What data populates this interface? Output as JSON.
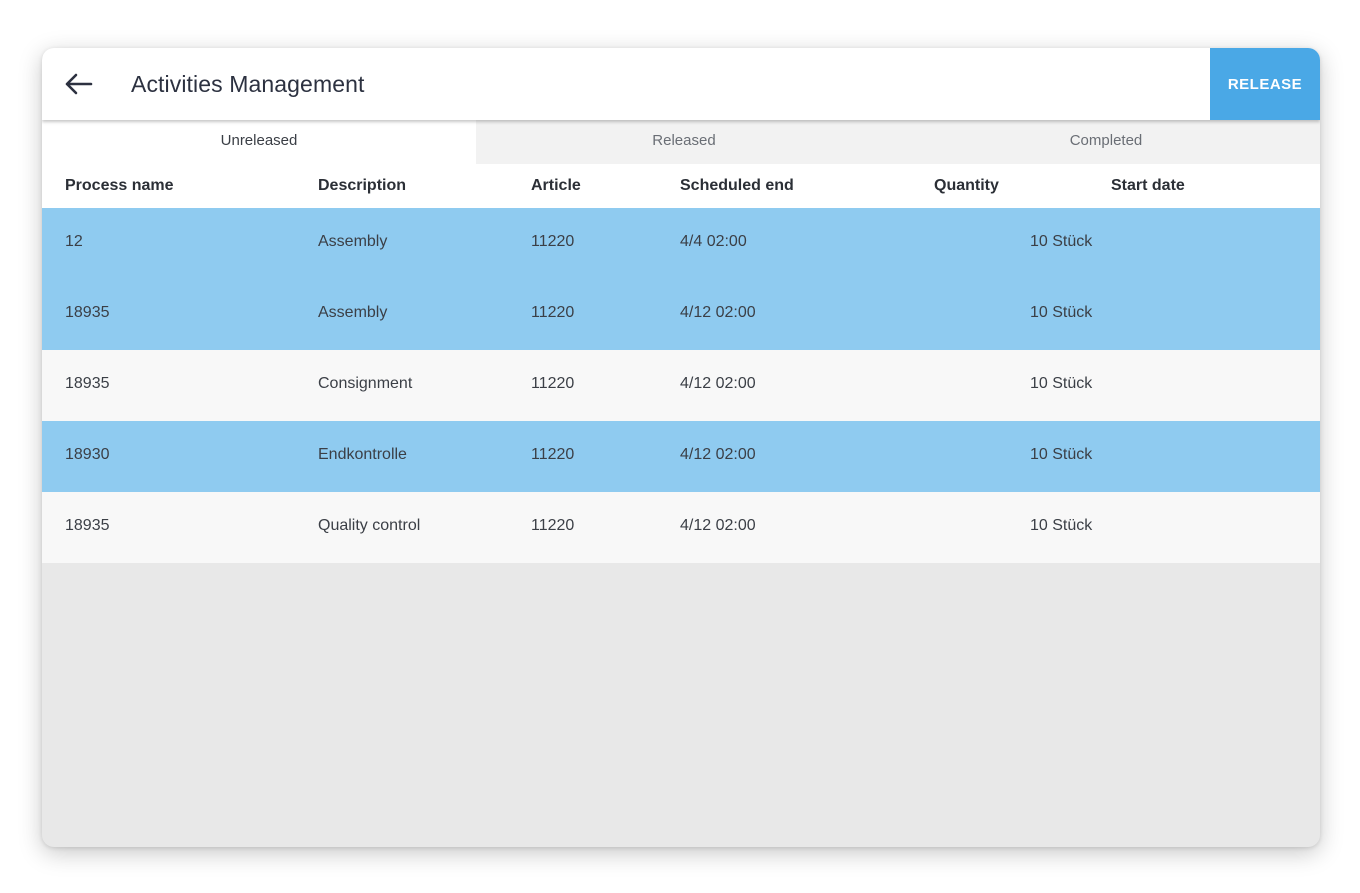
{
  "header": {
    "title": "Activities Management",
    "release_label": "RELEASE"
  },
  "tabs": [
    {
      "label": "Unreleased",
      "active": true
    },
    {
      "label": "Released",
      "active": false
    },
    {
      "label": "Completed",
      "active": false
    }
  ],
  "columns": {
    "process_name": "Process name",
    "description": "Description",
    "article": "Article",
    "scheduled_end": "Scheduled end",
    "quantity": "Quantity",
    "start_date": "Start date"
  },
  "rows": [
    {
      "process_name": "12",
      "description": "Assembly",
      "article": "11220",
      "scheduled_end": "4/4  02:00",
      "quantity": "10 Stück",
      "start_date": "",
      "selected": true
    },
    {
      "process_name": "18935",
      "description": "Assembly",
      "article": "11220",
      "scheduled_end": "4/12  02:00",
      "quantity": "10 Stück",
      "start_date": "",
      "selected": true
    },
    {
      "process_name": "18935",
      "description": "Consignment",
      "article": "11220",
      "scheduled_end": "4/12  02:00",
      "quantity": "10 Stück",
      "start_date": "",
      "selected": false
    },
    {
      "process_name": "18930",
      "description": "Endkontrolle",
      "article": "11220",
      "scheduled_end": "4/12  02:00",
      "quantity": "10 Stück",
      "start_date": "",
      "selected": true
    },
    {
      "process_name": "18935",
      "description": "Quality control",
      "article": "11220",
      "scheduled_end": "4/12  02:00",
      "quantity": "10 Stück",
      "start_date": "",
      "selected": false
    }
  ],
  "colors": {
    "accent": "#4aa8e6",
    "selected_row": "#8fcbf0",
    "row": "#f8f8f8",
    "empty_area": "#e8e8e8"
  },
  "icons": {
    "back": "arrow-left-icon"
  }
}
